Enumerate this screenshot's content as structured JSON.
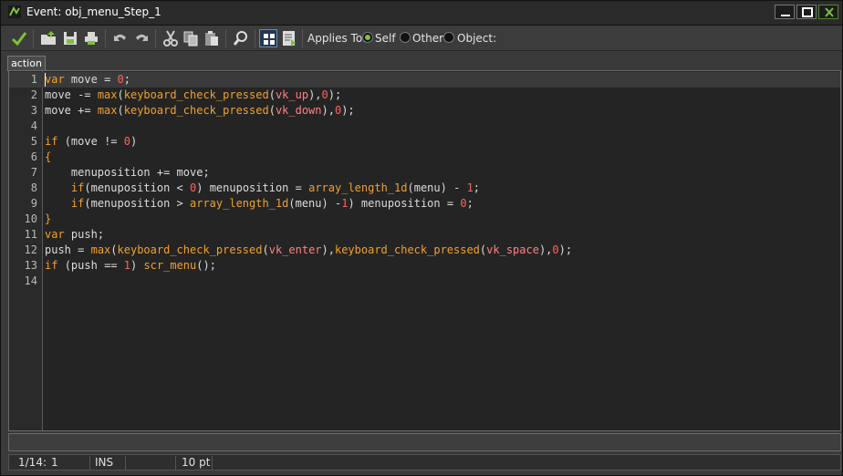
{
  "window": {
    "title": "Event: obj_menu_Step_1",
    "accent": "#7ec13a"
  },
  "toolbar": {
    "icons": [
      "check-icon",
      "open-folder-icon",
      "save-icon",
      "print-icon",
      "undo-icon",
      "redo-icon",
      "cut-icon",
      "copy-icon",
      "paste-icon",
      "find-icon",
      "grid-icon",
      "code-file-icon"
    ],
    "applies_label": "Applies To:",
    "applies_options": [
      {
        "label": "Self",
        "selected": true
      },
      {
        "label": "Other",
        "selected": false
      },
      {
        "label": "Object:",
        "selected": false
      }
    ]
  },
  "tabs": [
    {
      "label": "action"
    }
  ],
  "editor": {
    "lines": [
      {
        "n": "1",
        "text": "var move = 0;"
      },
      {
        "n": "2",
        "text": "move -= max(keyboard_check_pressed(vk_up),0);"
      },
      {
        "n": "3",
        "text": "move += max(keyboard_check_pressed(vk_down),0);"
      },
      {
        "n": "4",
        "text": ""
      },
      {
        "n": "5",
        "text": "if (move != 0)"
      },
      {
        "n": "6",
        "text": "{"
      },
      {
        "n": "7",
        "text": "    menuposition += move;"
      },
      {
        "n": "8",
        "text": "    if(menuposition < 0) menuposition = array_length_1d(menu) - 1;"
      },
      {
        "n": "9",
        "text": "    if(menuposition > array_length_1d(menu) -1) menuposition = 0;"
      },
      {
        "n": "10",
        "text": "}"
      },
      {
        "n": "11",
        "text": "var push;"
      },
      {
        "n": "12",
        "text": "push = max(keyboard_check_pressed(vk_enter),keyboard_check_pressed(vk_space),0);"
      },
      {
        "n": "13",
        "text": "if (push == 1) scr_menu();"
      },
      {
        "n": "14",
        "text": ""
      }
    ]
  },
  "status": {
    "position": "1/14:",
    "column": "1",
    "mode": "INS",
    "font_size": "10 pt"
  }
}
